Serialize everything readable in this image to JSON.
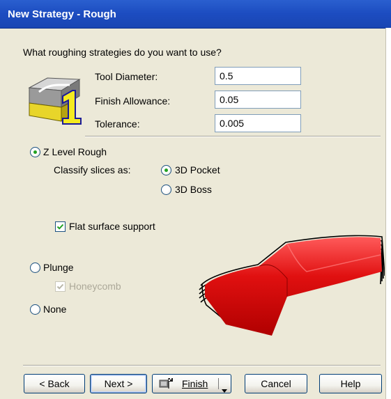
{
  "window": {
    "title": "New Strategy - Rough"
  },
  "prompt": "What roughing strategies do you want to use?",
  "fields": [
    {
      "label": "Tool Diameter:",
      "value": "0.5"
    },
    {
      "label": "Finish Allowance:",
      "value": "0.05"
    },
    {
      "label": "Tolerance:",
      "value": "0.005"
    }
  ],
  "strategy": {
    "z_level_label": "Z Level Rough",
    "z_level_selected": true,
    "classify_label": "Classify slices as:",
    "pocket_label": "3D Pocket",
    "pocket_selected": true,
    "boss_label": "3D Boss",
    "boss_selected": false,
    "flat_support_label": "Flat surface support",
    "flat_support_checked": true,
    "plunge_label": "Plunge",
    "plunge_selected": false,
    "honeycomb_label": "Honeycomb",
    "honeycomb_checked": true,
    "honeycomb_disabled": true,
    "none_label": "None",
    "none_selected": false
  },
  "buttons": {
    "back": "< Back",
    "next": "Next >",
    "finish": "Finish",
    "cancel": "Cancel",
    "help": "Help"
  },
  "icons": {
    "step_icon": "step-1-roughing-icon",
    "preview": "z-level-preview-image",
    "finish_icon": "finish-flag-icon",
    "dropdown": "chevron-down-icon"
  },
  "colors": {
    "title_bar": "#1c4cc0",
    "dialog_bg": "#ece9d8",
    "radio_dot": "#21a121",
    "preview_red": "#e01010"
  }
}
